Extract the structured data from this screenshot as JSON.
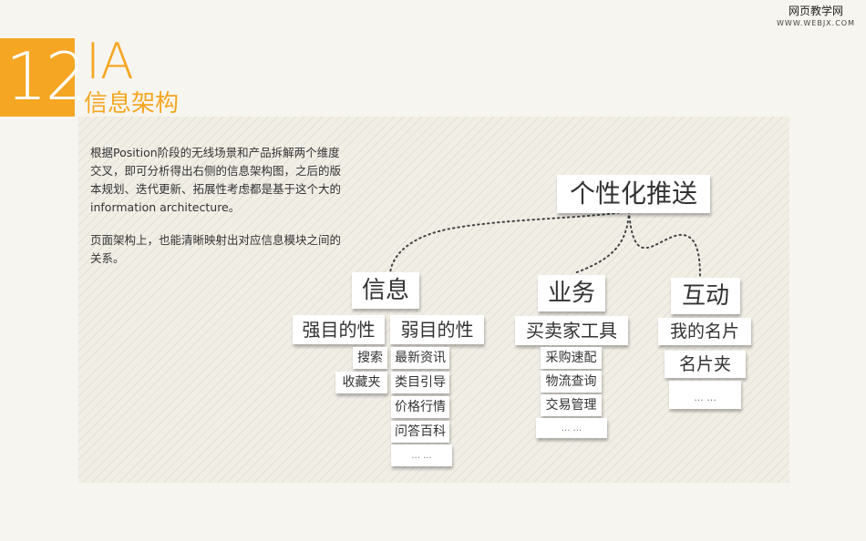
{
  "watermark": {
    "text": "网页教学网",
    "sub": "WWW.WEBJX.COM"
  },
  "header": {
    "number": "12",
    "title_en": "IA",
    "title_cn": "信息架构"
  },
  "description": {
    "paragraphs": [
      "根据Position阶段的无线场景和产品拆解两个维度交叉，即可分析得出右侧的信息架构图，之后的版本规划、迭代更新、拓展性考虑都是基于这个大的information architecture。",
      "页面架构上，也能清晰映射出对应信息模块之间的关系。"
    ]
  },
  "diagram": {
    "root": "个性化推送",
    "info": {
      "label": "信息",
      "strong": {
        "label": "强目的性",
        "items": [
          "搜索",
          "收藏夹"
        ]
      },
      "weak": {
        "label": "弱目的性",
        "items": [
          "最新资讯",
          "类目引导",
          "价格行情",
          "问答百科",
          "... ..."
        ]
      }
    },
    "business": {
      "label": "业务",
      "tools": {
        "label": "买卖家工具",
        "items": [
          "采购速配",
          "物流查询",
          "交易管理",
          "... ..."
        ]
      }
    },
    "interact": {
      "label": "互动",
      "items": [
        "我的名片",
        "名片夹",
        "... ..."
      ]
    }
  }
}
